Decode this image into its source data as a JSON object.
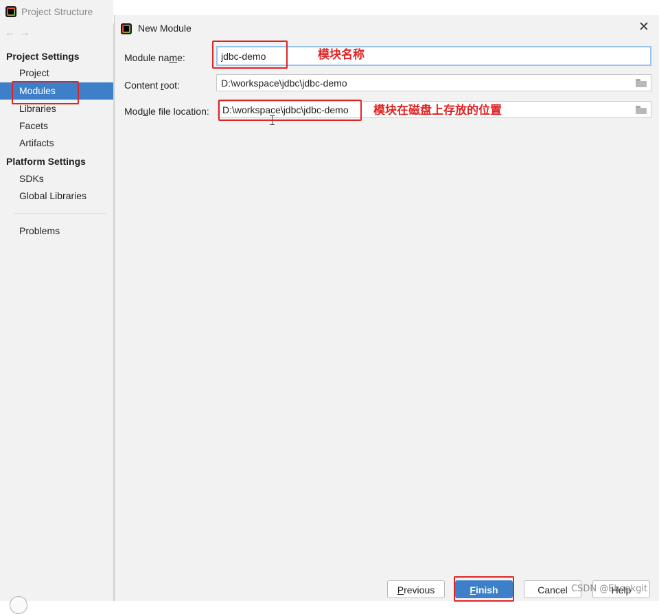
{
  "outer_window": {
    "title": "Project Structure"
  },
  "sidebar": {
    "nav_back": "←",
    "nav_forward": "→",
    "project_settings_heading": "Project Settings",
    "project_items": [
      {
        "label": "Project"
      },
      {
        "label": "Modules"
      },
      {
        "label": "Libraries"
      },
      {
        "label": "Facets"
      },
      {
        "label": "Artifacts"
      }
    ],
    "platform_settings_heading": "Platform Settings",
    "platform_items": [
      {
        "label": "SDKs"
      },
      {
        "label": "Global Libraries"
      }
    ],
    "problems_label": "Problems"
  },
  "dialog": {
    "title": "New Module",
    "close_glyph": "✕",
    "module_name": {
      "label_pre": "Module na",
      "label_mnemonic": "m",
      "label_post": "e:",
      "value": "jdbc-demo"
    },
    "content_root": {
      "label_pre": "Content ",
      "label_mnemonic": "r",
      "label_post": "oot:",
      "value": "D:\\workspace\\jdbc\\jdbc-demo"
    },
    "module_file_location": {
      "label_pre": "Mod",
      "label_mnemonic": "u",
      "label_post": "le file location:",
      "value": "D:\\workspace\\jdbc\\jdbc-demo"
    },
    "annotation_name": "模块名称",
    "annotation_location": "模块在磁盘上存放的位置",
    "buttons": {
      "previous_mnemonic": "P",
      "previous_rest": "revious",
      "finish_mnemonic": "F",
      "finish_rest": "inish",
      "cancel": "Cancel",
      "help": "Help"
    }
  },
  "watermark": "CSDN @Ebookgit",
  "colors": {
    "selection": "#3d7fc9",
    "annotation_red": "#e02424",
    "panel_bg": "#f2f2f2"
  }
}
